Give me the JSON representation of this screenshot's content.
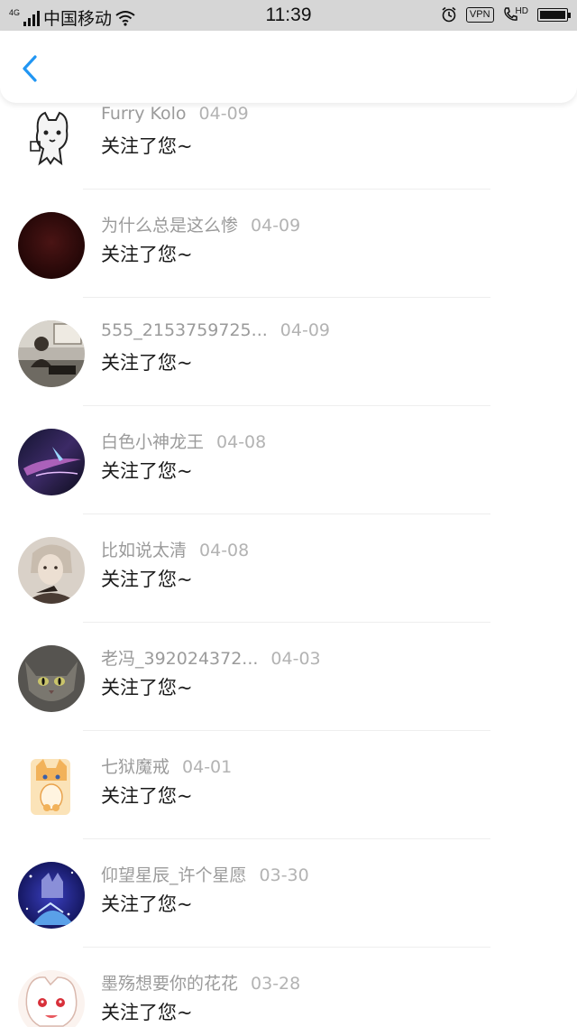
{
  "status_bar": {
    "network_tag": "4G",
    "carrier": "中国移动",
    "time": "11:39",
    "vpn_label": "VPN",
    "hd_label": "HD"
  },
  "nav": {
    "accent_color": "#2196f3"
  },
  "notifications": [
    {
      "name": "Furry Kolo",
      "date": "04-09",
      "message": "关注了您~"
    },
    {
      "name": "为什么总是这么惨",
      "date": "04-09",
      "message": "关注了您~"
    },
    {
      "name": "555_2153759725...",
      "date": "04-09",
      "message": "关注了您~"
    },
    {
      "name": "白色小神龙王",
      "date": "04-08",
      "message": "关注了您~"
    },
    {
      "name": "比如说太清",
      "date": "04-08",
      "message": "关注了您~"
    },
    {
      "name": "老冯_392024372...",
      "date": "04-03",
      "message": "关注了您~"
    },
    {
      "name": "七狱魔戒",
      "date": "04-01",
      "message": "关注了您~"
    },
    {
      "name": "仰望星辰_许个星愿",
      "date": "03-30",
      "message": "关注了您~"
    },
    {
      "name": "墨殇想要你的花花",
      "date": "03-28",
      "message": "关注了您~"
    }
  ]
}
